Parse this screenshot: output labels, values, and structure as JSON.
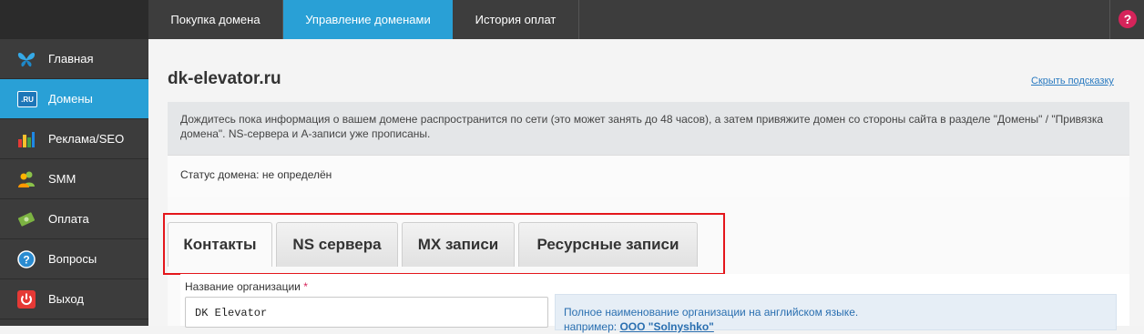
{
  "topnav": {
    "tabs": [
      {
        "label": "Покупка домена",
        "active": false
      },
      {
        "label": "Управление доменами",
        "active": true
      },
      {
        "label": "История оплат",
        "active": false
      }
    ],
    "help_symbol": "?"
  },
  "sidebar": {
    "items": [
      {
        "label": "Главная",
        "icon": "butterfly-icon"
      },
      {
        "label": "Домены",
        "icon": "ru-domain-icon",
        "icon_text": ".RU",
        "active": true
      },
      {
        "label": "Реклама/SEO",
        "icon": "bar-chart-icon"
      },
      {
        "label": "SMM",
        "icon": "people-icon"
      },
      {
        "label": "Оплата",
        "icon": "money-icon"
      },
      {
        "label": "Вопросы",
        "icon": "question-icon"
      },
      {
        "label": "Выход",
        "icon": "power-icon"
      }
    ]
  },
  "main": {
    "domain_title": "dk-elevator.ru",
    "hide_hint_link": "Скрыть подсказку",
    "hint_text": "Дождитесь пока информация о вашем домене распространится по сети (это может занять до 48 часов), а затем привяжите домен со стороны сайта в разделе \"Домены\" / \"Привязка домена\". NS-сервера и A-записи уже прописаны.",
    "status_text": "Статус домена: не определён",
    "tabs": [
      {
        "label": "Контакты",
        "active": true
      },
      {
        "label": "NS сервера"
      },
      {
        "label": "MX записи"
      },
      {
        "label": "Ресурсные записи"
      }
    ],
    "form": {
      "org_label": "Название организации",
      "required_mark": "*",
      "org_value": "DK Elevator",
      "org_hint_line1": "Полное наименование организации на английском языке.",
      "org_hint_prefix": "например:",
      "org_hint_example": "OOO \"Solnyshko\""
    }
  },
  "colors": {
    "accent": "#29a0d6",
    "highlight_frame": "#e4161b",
    "help_badge": "#d6245a"
  }
}
